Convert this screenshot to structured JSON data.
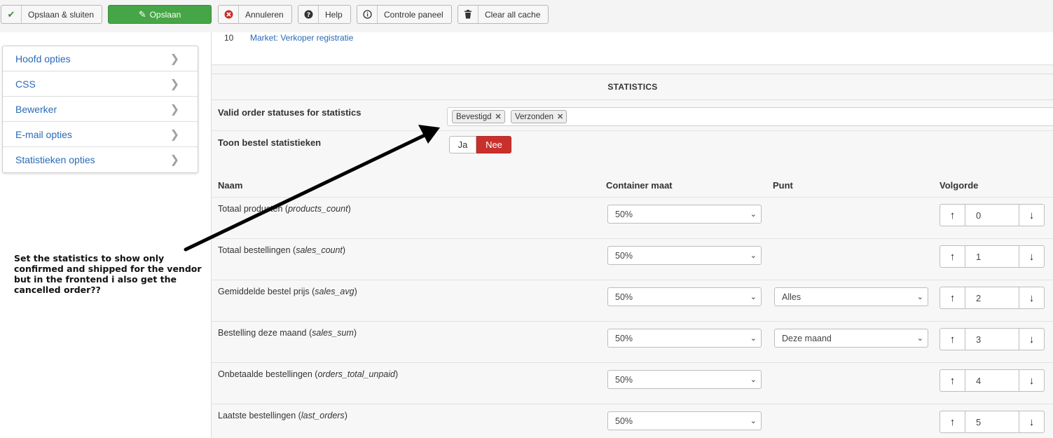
{
  "toolbar": {
    "save_close": "Opslaan & sluiten",
    "save": "Opslaan",
    "cancel": "Annuleren",
    "help": "Help",
    "control_panel": "Controle paneel",
    "clear_cache": "Clear all cache"
  },
  "sidebar": {
    "items": [
      {
        "label": "Hoofd opties"
      },
      {
        "label": "CSS"
      },
      {
        "label": "Bewerker"
      },
      {
        "label": "E-mail opties"
      },
      {
        "label": "Statistieken opties"
      }
    ]
  },
  "note": "Set the statistics to show only confirmed and shipped for the vendor\nbut in the frontend i also get the cancelled order??",
  "top_entry": {
    "number": "10",
    "link": "Market: Verkoper registratie"
  },
  "statistics": {
    "title": "STATISTICS",
    "valid_statuses_label": "Valid order statuses for statistics",
    "tags": [
      "Bevestigd",
      "Verzonden"
    ],
    "show_label": "Toon bestel statistieken",
    "toggle": {
      "yes": "Ja",
      "no": "Nee",
      "selected": "Nee"
    },
    "columns": {
      "name": "Naam",
      "size": "Container maat",
      "point": "Punt",
      "order": "Volgorde"
    },
    "rows": [
      {
        "name": "Totaal producten",
        "key": "products_count",
        "size": "50%",
        "point": "",
        "order": "0"
      },
      {
        "name": "Totaal bestellingen",
        "key": "sales_count",
        "size": "50%",
        "point": "",
        "order": "1"
      },
      {
        "name": "Gemiddelde bestel prijs",
        "key": "sales_avg",
        "size": "50%",
        "point": "Alles",
        "order": "2"
      },
      {
        "name": "Bestelling deze maand",
        "key": "sales_sum",
        "size": "50%",
        "point": "Deze maand",
        "order": "3"
      },
      {
        "name": "Onbetaalde bestellingen",
        "key": "orders_total_unpaid",
        "size": "50%",
        "point": "",
        "order": "4"
      },
      {
        "name": "Laatste bestellingen",
        "key": "last_orders",
        "size": "50%",
        "point": "",
        "order": "5"
      }
    ]
  },
  "colors": {
    "green": "#46a546",
    "red": "#c9302c",
    "link": "#2a69b8"
  }
}
